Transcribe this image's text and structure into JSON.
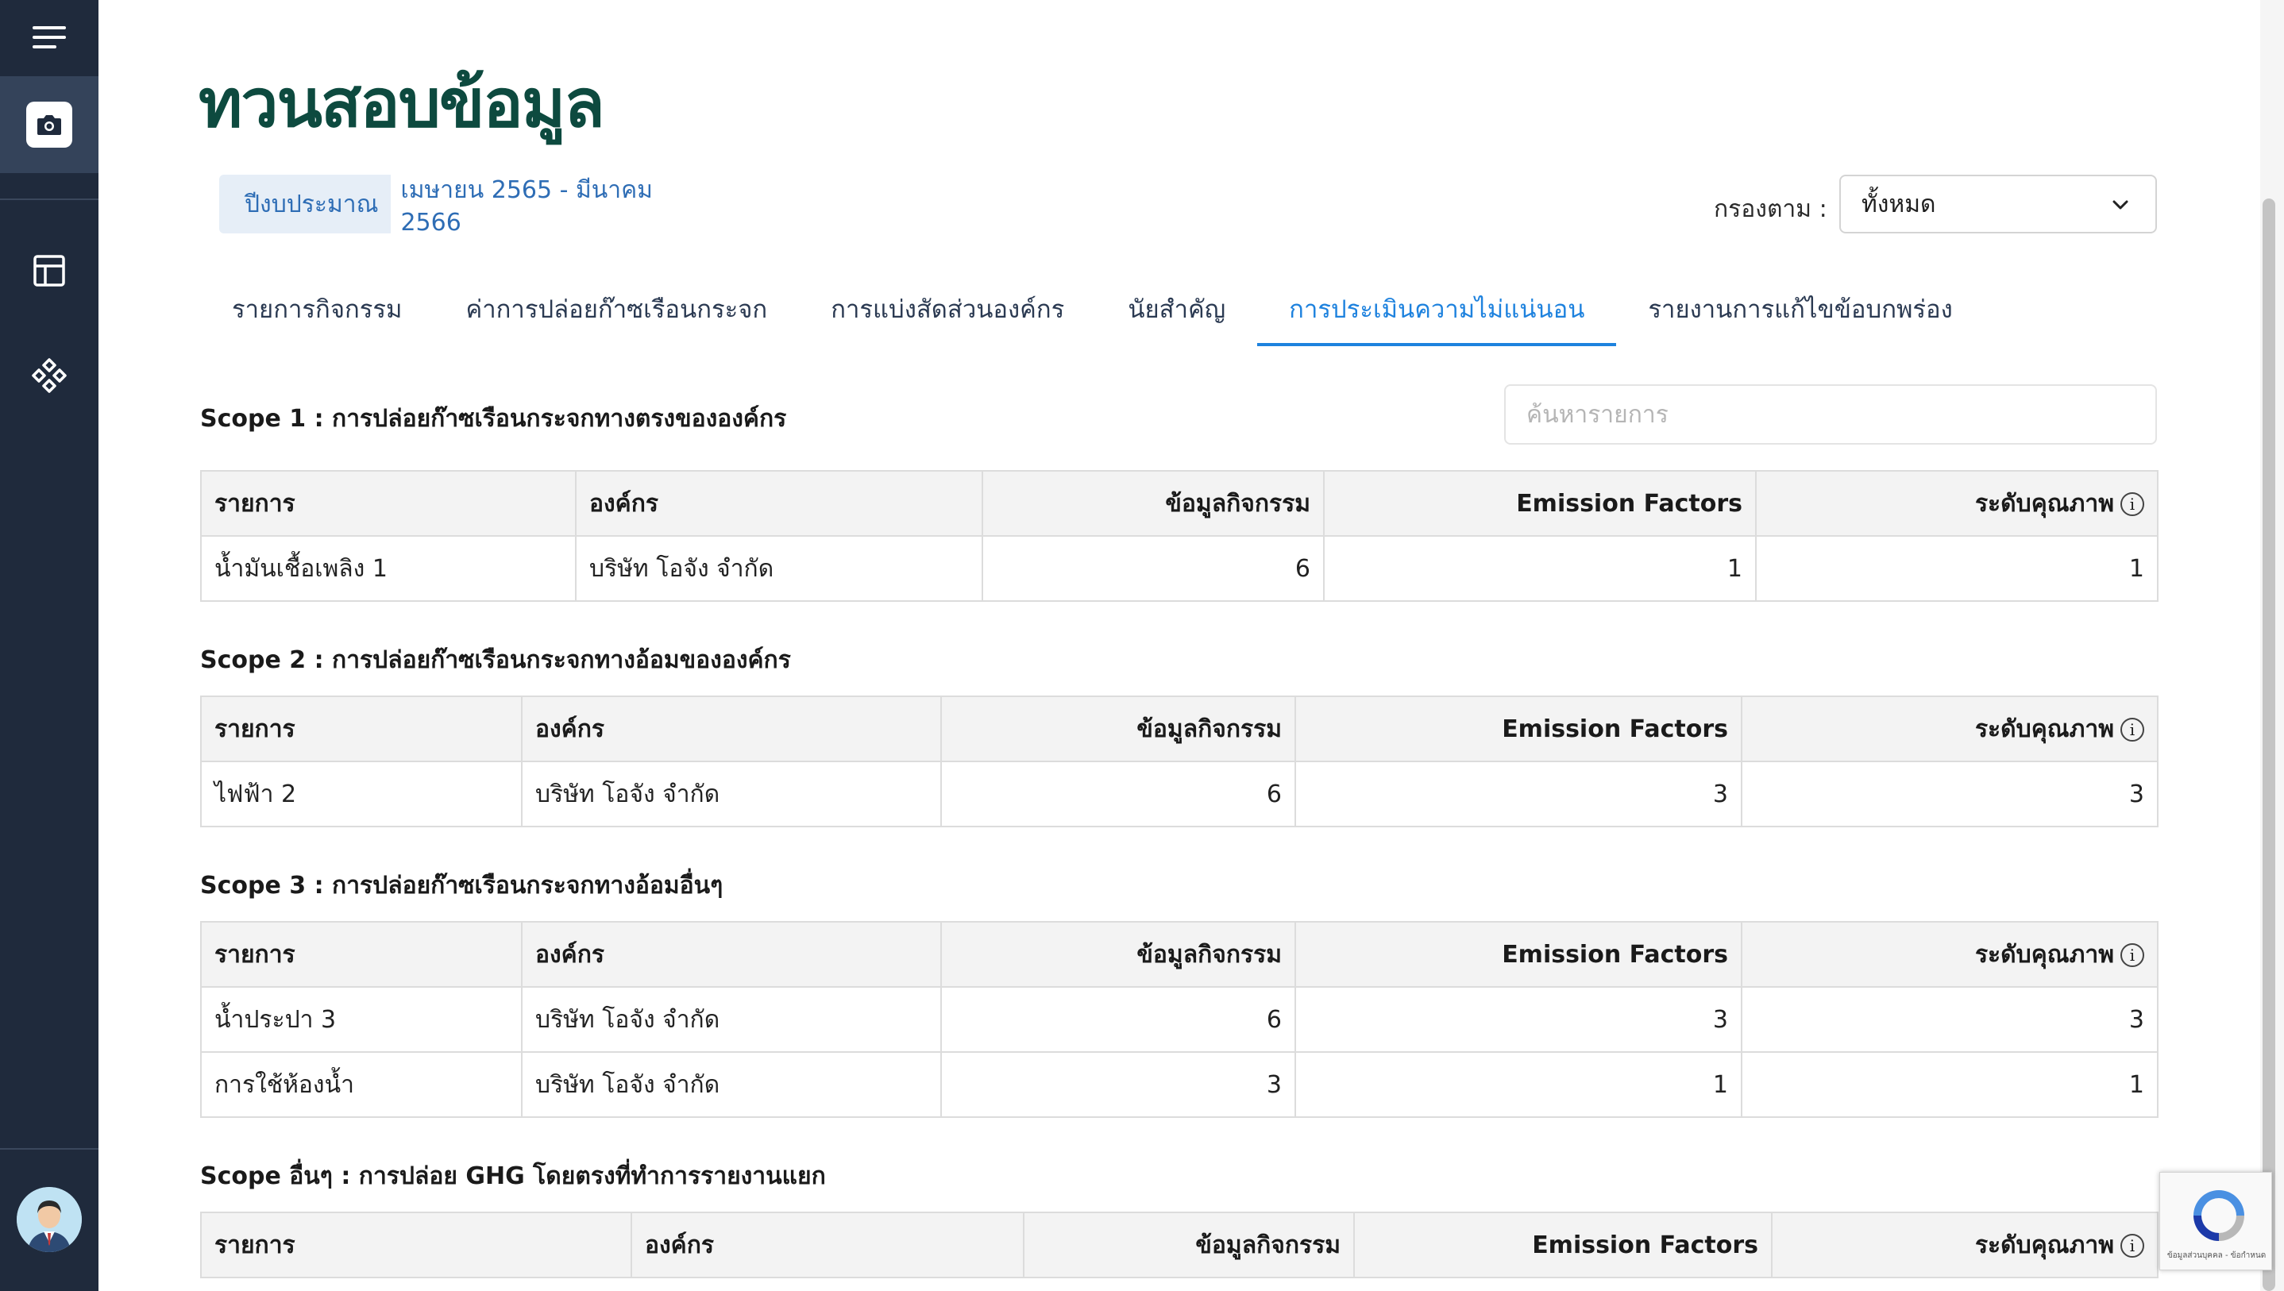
{
  "page": {
    "title": "ทวนสอบข้อมูล"
  },
  "fiscal_year": {
    "label": "ปีงบประมาณ",
    "value": "เมษายน 2565 - มีนาคม 2566"
  },
  "filter": {
    "label": "กรองตาม :",
    "selected": "ทั้งหมด"
  },
  "tabs": [
    {
      "label": "รายการกิจกรรม",
      "active": false
    },
    {
      "label": "ค่าการปล่อยก๊าซเรือนกระจก",
      "active": false
    },
    {
      "label": "การแบ่งสัดส่วนองค์กร",
      "active": false
    },
    {
      "label": "นัยสำคัญ",
      "active": false
    },
    {
      "label": "การประเมินความไม่แน่นอน",
      "active": true
    },
    {
      "label": "รายงานการแก้ไขข้อบกพร่อง",
      "active": false
    }
  ],
  "search": {
    "placeholder": "ค้นหารายการ"
  },
  "columns": {
    "item": "รายการ",
    "org": "องค์กร",
    "activity_data": "ข้อมูลกิจกรรม",
    "emission_factors": "Emission Factors",
    "quality_level": "ระดับคุณภาพ"
  },
  "sections": [
    {
      "title": "Scope 1 : การปล่อยก๊าซเรือนกระจกทางตรงขององค์กร",
      "rows": [
        {
          "item": "น้ำมันเชื้อเพลิง 1",
          "org": "บริษัท โอจัง จำกัด",
          "activity_data": "6",
          "emission_factors": "1",
          "quality_level": "1"
        }
      ]
    },
    {
      "title": "Scope 2 : การปล่อยก๊าซเรือนกระจกทางอ้อมขององค์กร",
      "rows": [
        {
          "item": "ไฟฟ้า 2",
          "org": "บริษัท โอจัง จำกัด",
          "activity_data": "6",
          "emission_factors": "3",
          "quality_level": "3"
        }
      ]
    },
    {
      "title": "Scope 3 : การปล่อยก๊าซเรือนกระจกทางอ้อมอื่นๆ",
      "rows": [
        {
          "item": "น้ำประปา 3",
          "org": "บริษัท โอจัง จำกัด",
          "activity_data": "6",
          "emission_factors": "3",
          "quality_level": "3"
        },
        {
          "item": "การใช้ห้องน้ำ",
          "org": "บริษัท โอจัง จำกัด",
          "activity_data": "3",
          "emission_factors": "1",
          "quality_level": "1"
        }
      ]
    },
    {
      "title": "Scope อื่นๆ : การปล่อย GHG โดยตรงที่ทำการรายงานแยก",
      "rows": []
    }
  ],
  "sidebar": {
    "items": [
      {
        "icon": "hamburger-menu-icon"
      },
      {
        "icon": "camera-icon",
        "active": true
      },
      {
        "icon": "layout-table-icon"
      },
      {
        "icon": "components-diamond-icon"
      }
    ]
  },
  "recaptcha": {
    "text": "ข้อมูลส่วนบุคคล - ข้อกำหนด"
  }
}
